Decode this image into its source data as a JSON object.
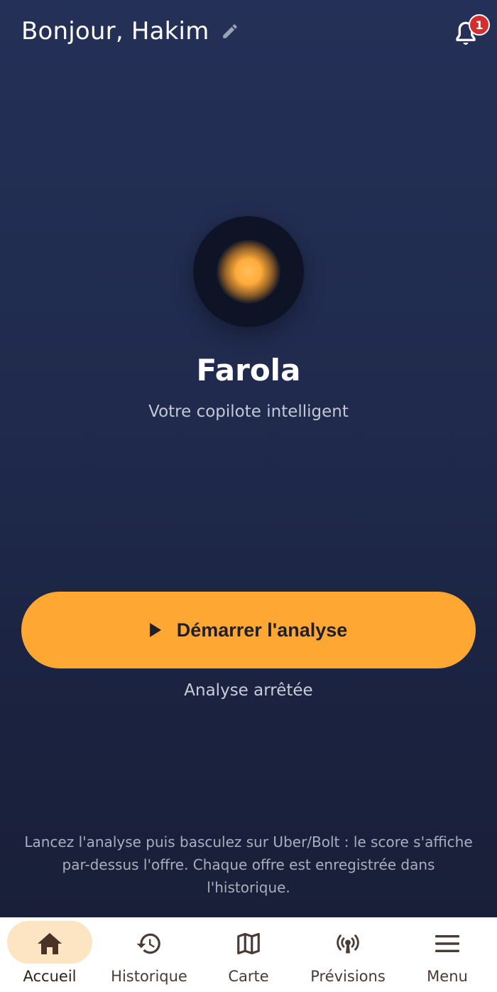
{
  "header": {
    "greeting": "Bonjour, Hakim",
    "edit_icon": "pencil-icon",
    "notifications_icon": "bell-icon",
    "notifications_count": "1"
  },
  "hero": {
    "logo_icon": "glowing-orb-icon",
    "title": "Farola",
    "subtitle": "Votre copilote intelligent"
  },
  "action": {
    "start_icon": "play-icon",
    "start_label": "Démarrer l'analyse",
    "status": "Analyse arrêtée"
  },
  "help_text": "Lancez l'analyse puis basculez sur Uber/Bolt : le score s'affiche par-dessus l'offre. Chaque offre est enregistrée dans l'historique.",
  "nav": {
    "active": "Accueil",
    "items": [
      {
        "label": "Accueil",
        "icon": "home-icon"
      },
      {
        "label": "Historique",
        "icon": "history-icon"
      },
      {
        "label": "Carte",
        "icon": "map-icon"
      },
      {
        "label": "Prévisions",
        "icon": "broadcast-icon"
      },
      {
        "label": "Menu",
        "icon": "menu-icon"
      }
    ]
  },
  "colors": {
    "background_top": "#243057",
    "background_bottom": "#191f38",
    "accent": "#ffa733",
    "badge": "#d32f2f",
    "nav_active_pill": "#fde5c4"
  }
}
